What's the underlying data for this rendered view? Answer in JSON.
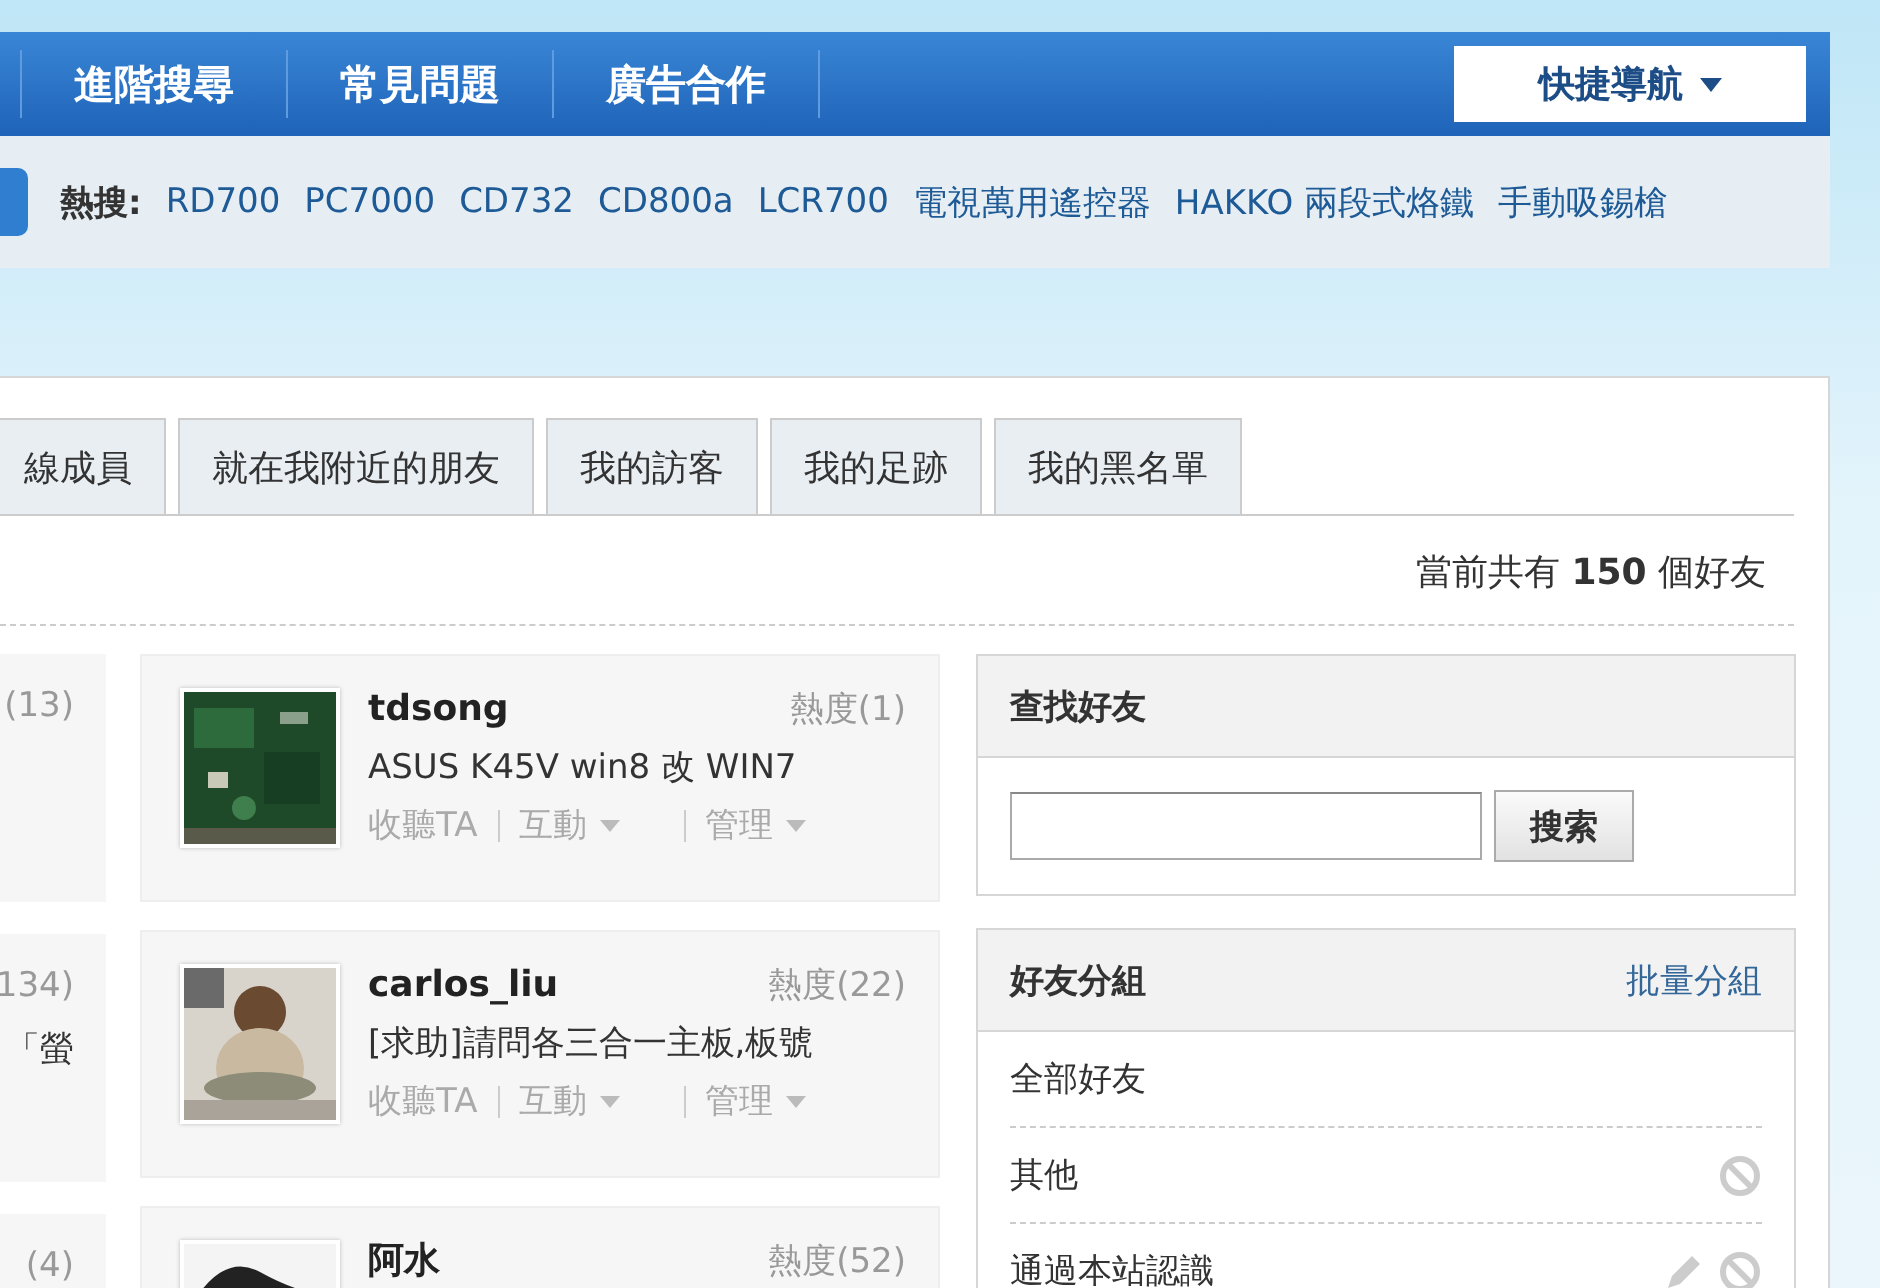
{
  "nav": {
    "items": [
      "進階搜尋",
      "常見問題",
      "廣告合作"
    ],
    "quick_nav": "快捷導航"
  },
  "hot_search": {
    "label": "熱搜:",
    "terms": [
      "RD700",
      "PC7000",
      "CD732",
      "CD800a",
      "LCR700",
      "電視萬用遙控器",
      "HAKKO 兩段式烙鐵",
      "手動吸錫槍"
    ]
  },
  "tabs": [
    {
      "label": "線成員",
      "selected": false
    },
    {
      "label": "就在我附近的朋友",
      "selected": false
    },
    {
      "label": "我的訪客",
      "selected": false
    },
    {
      "label": "我的足跡",
      "selected": false
    },
    {
      "label": "我的黑名單",
      "selected": false
    }
  ],
  "friend_count": "當前共有 **150** 個好友",
  "left_column": [
    {
      "line_1": "(13)"
    },
    {
      "line_1": "134)",
      "line_2": "「螢"
    },
    {
      "line_1": "(4)"
    }
  ],
  "friends": [
    {
      "name": "tdsong",
      "heat": "熱度(1)",
      "post": "ASUS K45V win8 改 WIN7",
      "actions": [
        "收聽TA",
        "互動",
        "管理"
      ]
    },
    {
      "name": "carlos_liu",
      "heat": "熱度(22)",
      "post": "[求助]請問各三合一主板,板號",
      "actions": [
        "收聽TA",
        "互動",
        "管理"
      ]
    },
    {
      "name": "阿水",
      "heat": "熱度(52)"
    }
  ],
  "find_friends": {
    "title": "查找好友",
    "button": "搜索"
  },
  "groups": {
    "title": "好友分組",
    "link": "批量分組",
    "items": [
      {
        "name": "全部好友",
        "editable": false,
        "deletable": false
      },
      {
        "name": "其他",
        "editable": false,
        "deletable": true
      },
      {
        "name": "通過本站認識",
        "editable": true,
        "deletable": true
      }
    ]
  }
}
